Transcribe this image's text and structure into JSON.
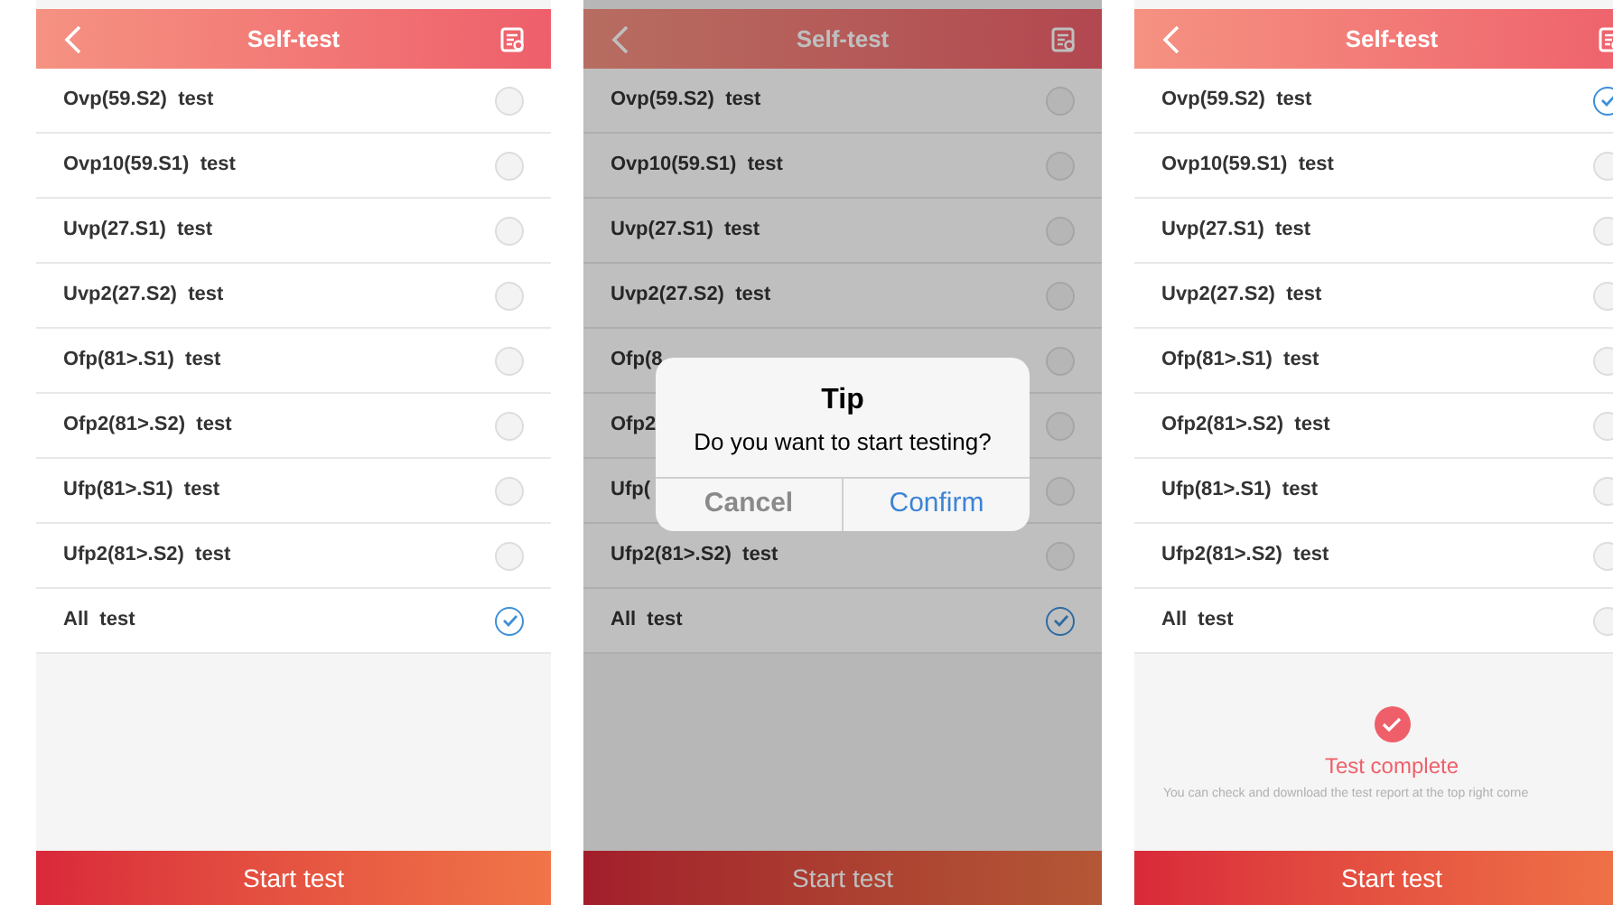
{
  "screens": [
    {
      "title": "Self-test",
      "dimmed": false,
      "rows": [
        {
          "label": "Ovp(59.S2)  test",
          "checked": false
        },
        {
          "label": "Ovp10(59.S1)  test",
          "checked": false
        },
        {
          "label": "Uvp(27.S1)  test",
          "checked": false
        },
        {
          "label": "Uvp2(27.S2)  test",
          "checked": false
        },
        {
          "label": "Ofp(81>.S1)  test",
          "checked": false
        },
        {
          "label": "Ofp2(81>.S2)  test",
          "checked": false
        },
        {
          "label": "Ufp(81>.S1)  test",
          "checked": false
        },
        {
          "label": "Ufp2(81>.S2)  test",
          "checked": false
        },
        {
          "label": "All  test",
          "checked": true
        }
      ],
      "start_button": "Start test"
    },
    {
      "title": "Self-test",
      "dimmed": true,
      "rows": [
        {
          "label": "Ovp(59.S2)  test",
          "checked": false
        },
        {
          "label": "Ovp10(59.S1)  test",
          "checked": false
        },
        {
          "label": "Uvp(27.S1)  test",
          "checked": false
        },
        {
          "label": "Uvp2(27.S2)  test",
          "checked": false
        },
        {
          "label": "Ofp(8",
          "checked": false
        },
        {
          "label": "Ofp2",
          "checked": false
        },
        {
          "label": "Ufp(",
          "checked": false
        },
        {
          "label": "Ufp2(81>.S2)  test",
          "checked": false
        },
        {
          "label": "All  test",
          "checked": true
        }
      ],
      "dialog": {
        "title": "Tip",
        "message": "Do you want to start testing?",
        "buttons": [
          {
            "label": "Cancel",
            "kind": "cancel"
          },
          {
            "label": "Confirm",
            "kind": "confirm"
          }
        ]
      },
      "start_button": "Start test"
    },
    {
      "title": "Self-test",
      "dimmed": false,
      "rows": [
        {
          "label": "Ovp(59.S2)  test",
          "checked": true
        },
        {
          "label": "Ovp10(59.S1)  test",
          "checked": false
        },
        {
          "label": "Uvp(27.S1)  test",
          "checked": false
        },
        {
          "label": "Uvp2(27.S2)  test",
          "checked": false
        },
        {
          "label": "Ofp(81>.S1)  test",
          "checked": false
        },
        {
          "label": "Ofp2(81>.S2)  test",
          "checked": false
        },
        {
          "label": "Ufp(81>.S1)  test",
          "checked": false
        },
        {
          "label": "Ufp2(81>.S2)  test",
          "checked": false
        },
        {
          "label": "All  test",
          "checked": false
        }
      ],
      "result": {
        "title": "Test complete",
        "message": "You can check and download the test report at the top right corne"
      },
      "start_button": "Start test"
    }
  ]
}
